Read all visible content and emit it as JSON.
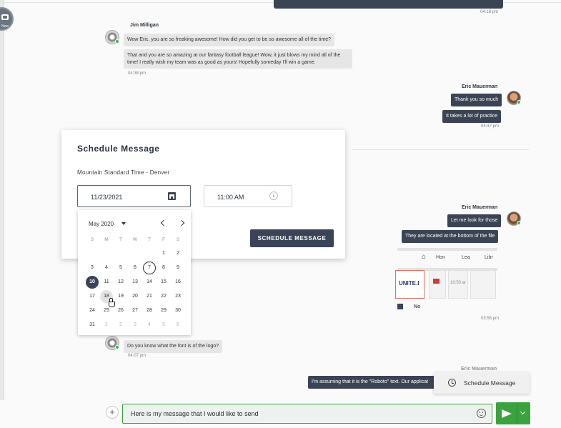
{
  "sidebar": {
    "fab_label": "New"
  },
  "messages": [
    {
      "id": "m1",
      "timestamp": "04:18 pm"
    },
    {
      "id": "m2",
      "author": "Jim Milligan",
      "bubbles": [
        "Wow Eric, you are so freaking awesome! How did you get to be so awesome all of the time?",
        "That and you are so amazing at our fantasy football league! Wow, it just blows my mind all of the time! I really wish my team was as good as yours! Hopefully someday I'll win a game."
      ],
      "timestamp": "04:38 pm"
    },
    {
      "id": "m3",
      "author": "Eric Mauerman",
      "bubbles": [
        "Thank you so much",
        "It takes a lot of practice"
      ],
      "timestamp": "04:47 pm"
    },
    {
      "id": "m4",
      "author": "Eric Mauerman",
      "bubbles": [
        "Let me look for those",
        "They are located at the bottom of the file"
      ],
      "timestamp": "03:58 pm",
      "attachment_texts": [
        "Hon",
        "Lea",
        "Libr",
        "UNITE.I",
        "10:50 ar",
        "No"
      ]
    },
    {
      "id": "m5",
      "bubbles": [
        "Do you know what the font is of the logo?"
      ],
      "timestamp": "04:07 pm"
    },
    {
      "id": "m6",
      "author": "Eric Mauerman",
      "bubbles": [
        "I'm assuming that it is the \"Roboto\" text. Our applicat"
      ]
    }
  ],
  "modal": {
    "title": "Schedule Message",
    "timezone": "Mountain Standard Time - Denver",
    "date_value": "11/23/2021",
    "time_value": "11:00 AM",
    "submit_label": "SCHEDULE MESSAGE"
  },
  "calendar": {
    "month_label": "May 2020",
    "weekdays": [
      "S",
      "M",
      "T",
      "W",
      "T",
      "F",
      "S"
    ],
    "weeks": [
      [
        "",
        "",
        "",
        "",
        "",
        "1",
        "2"
      ],
      [
        "3",
        "4",
        "5",
        "6",
        "7",
        "8",
        "9"
      ],
      [
        "10",
        "11",
        "12",
        "13",
        "14",
        "15",
        "16"
      ],
      [
        "17",
        "18",
        "19",
        "20",
        "21",
        "22",
        "23"
      ],
      [
        "24",
        "25",
        "26",
        "27",
        "28",
        "29",
        "30"
      ],
      [
        "31",
        "1",
        "2",
        "3",
        "4",
        "5",
        "6"
      ]
    ],
    "today": "7",
    "selected": "10",
    "hovered": "18"
  },
  "context_menu": {
    "item_label": "Schedule Message"
  },
  "composer": {
    "message_text": "Here is my message that I would like to send",
    "plus_label": "+"
  }
}
